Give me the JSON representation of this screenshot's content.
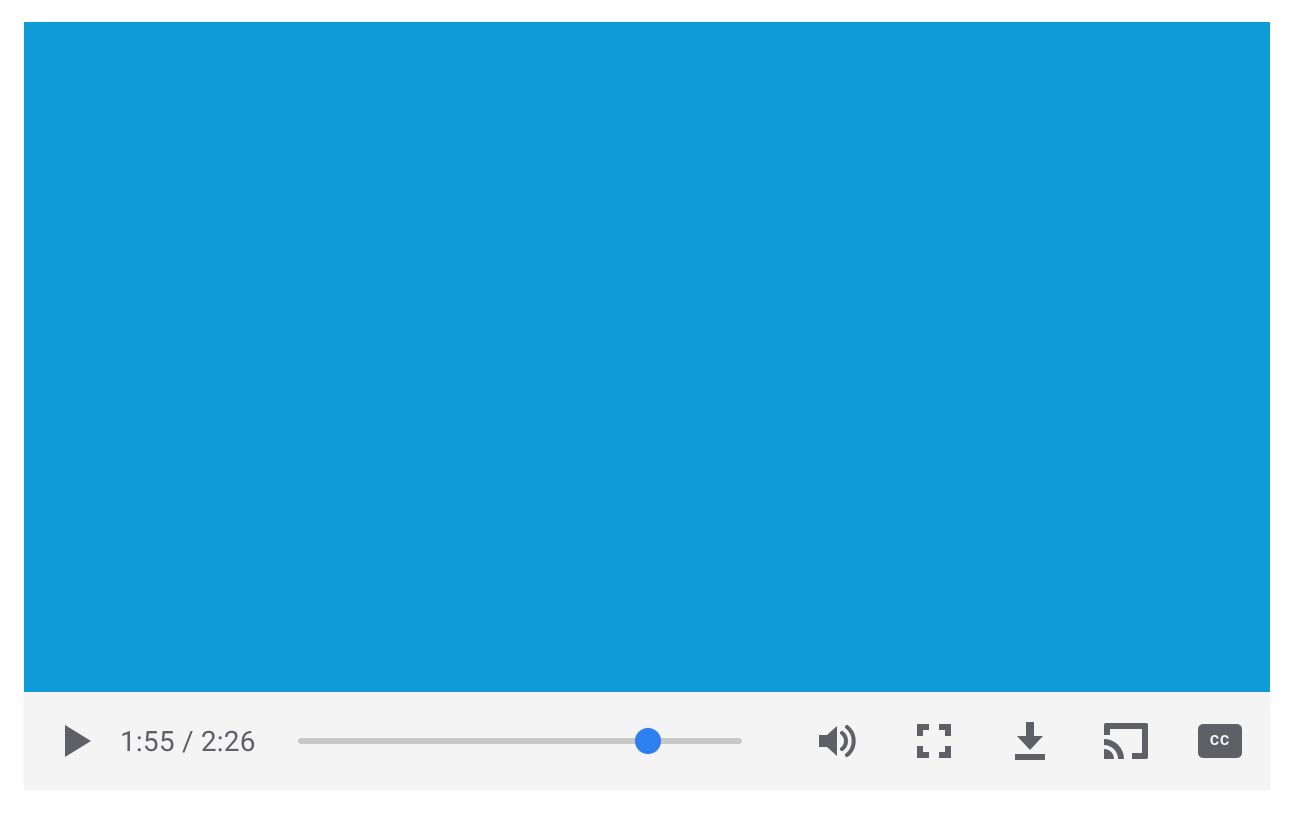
{
  "colors": {
    "video_bg": "#0e9bd8",
    "controls_bg": "#f4f4f4",
    "icon": "#5f6066",
    "track": "#c8c8c8",
    "thumb": "#2e7ff0"
  },
  "playback": {
    "current_time": "1:55",
    "duration": "2:26",
    "separator": " / ",
    "progress_percent": 78.8
  },
  "captions": {
    "label": "CC"
  }
}
